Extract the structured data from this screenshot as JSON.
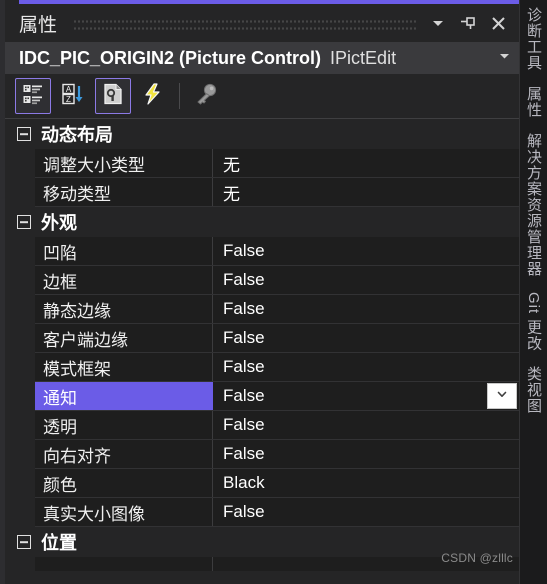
{
  "window": {
    "title": "属性",
    "accent_color": "#6b5ce7",
    "buttons": {
      "menu_label": "窗口位置菜单",
      "pin_label": "自动隐藏",
      "close_label": "关闭"
    }
  },
  "object_header": {
    "name": "IDC_PIC_ORIGIN2 (Picture Control)",
    "type": "IPictEdit",
    "dropdown_label": "选择对象"
  },
  "toolbar": {
    "items": [
      {
        "name": "categorized-view",
        "label": "按分类",
        "active": true
      },
      {
        "name": "alphabetical-view",
        "label": "按字母顺序",
        "active": false
      },
      {
        "name": "properties-view",
        "label": "属性",
        "active": true
      },
      {
        "name": "events-view",
        "label": "事件",
        "active": false
      },
      {
        "name": "property-pages",
        "label": "属性页",
        "active": false
      }
    ]
  },
  "grid": {
    "groups": [
      {
        "label": "动态布局",
        "expanded": true,
        "rows": [
          {
            "name": "调整大小类型",
            "value": "无",
            "selected": false,
            "dropdown": false
          },
          {
            "name": "移动类型",
            "value": "无",
            "selected": false,
            "dropdown": false
          }
        ]
      },
      {
        "label": "外观",
        "expanded": true,
        "rows": [
          {
            "name": "凹陷",
            "value": "False",
            "selected": false,
            "dropdown": false
          },
          {
            "name": "边框",
            "value": "False",
            "selected": false,
            "dropdown": false
          },
          {
            "name": "静态边缘",
            "value": "False",
            "selected": false,
            "dropdown": false
          },
          {
            "name": "客户端边缘",
            "value": "False",
            "selected": false,
            "dropdown": false
          },
          {
            "name": "模式框架",
            "value": "False",
            "selected": false,
            "dropdown": false
          },
          {
            "name": "通知",
            "value": "False",
            "selected": true,
            "dropdown": true
          },
          {
            "name": "透明",
            "value": "False",
            "selected": false,
            "dropdown": false
          },
          {
            "name": "向右对齐",
            "value": "False",
            "selected": false,
            "dropdown": false
          },
          {
            "name": "颜色",
            "value": "Black",
            "selected": false,
            "dropdown": false
          },
          {
            "name": "真实大小图像",
            "value": "False",
            "selected": false,
            "dropdown": false
          }
        ]
      },
      {
        "label": "位置",
        "expanded": true,
        "rows": [
          {
            "name": "",
            "value": "",
            "selected": false,
            "dropdown": false,
            "partial": true
          }
        ]
      }
    ],
    "selection_color": "#6b5ce7"
  },
  "vertical_tabs": [
    {
      "label": "诊断工具",
      "latin": false
    },
    {
      "label": "属性",
      "latin": false
    },
    {
      "label": "解决方案资源管理器",
      "latin": false
    },
    {
      "label": "Git 更改",
      "latin": true
    },
    {
      "label": "类视图",
      "latin": false
    }
  ],
  "watermark": "CSDN @zlllc"
}
